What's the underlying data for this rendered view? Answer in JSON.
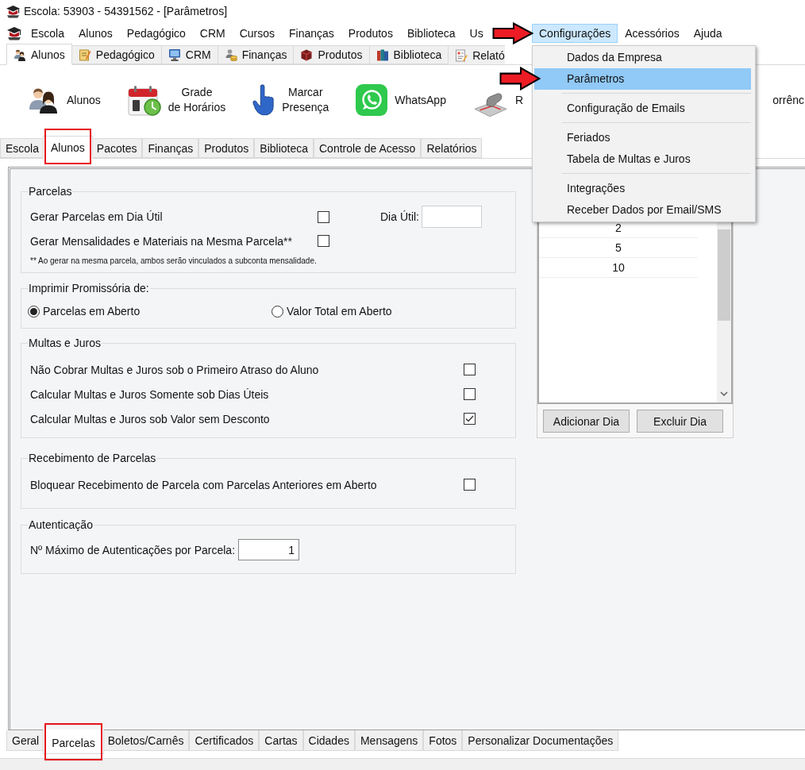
{
  "window": {
    "title": "Escola: 53903 - 54391562 - [Parâmetros]"
  },
  "menu_bar": {
    "items": [
      {
        "label": "Escola",
        "selected": false,
        "pointer_arrow": false
      },
      {
        "label": "Alunos",
        "selected": false,
        "pointer_arrow": false
      },
      {
        "label": "Pedagógico",
        "selected": false,
        "pointer_arrow": false
      },
      {
        "label": "CRM",
        "selected": false,
        "pointer_arrow": false
      },
      {
        "label": "Cursos",
        "selected": false,
        "pointer_arrow": false
      },
      {
        "label": "Finanças",
        "selected": false,
        "pointer_arrow": false
      },
      {
        "label": "Produtos",
        "selected": false,
        "pointer_arrow": false
      },
      {
        "label": "Biblioteca",
        "selected": false,
        "pointer_arrow": false
      },
      {
        "label": "Us",
        "selected": false,
        "pointer_arrow": false
      },
      {
        "label": "Configurações",
        "selected": true,
        "pointer_arrow": true
      },
      {
        "label": "Acessórios",
        "selected": false,
        "pointer_arrow": false
      },
      {
        "label": "Ajuda",
        "selected": false,
        "pointer_arrow": false
      }
    ]
  },
  "dropdown_menu": {
    "items": [
      {
        "kind": "item",
        "label": "Dados da Empresa",
        "selected": false,
        "pointer_arrow": false
      },
      {
        "kind": "item",
        "label": "Parâmetros",
        "selected": true,
        "pointer_arrow": true
      },
      {
        "kind": "separator"
      },
      {
        "kind": "item",
        "label": "Configuração de Emails",
        "selected": false,
        "pointer_arrow": false
      },
      {
        "kind": "separator"
      },
      {
        "kind": "item",
        "label": "Feriados",
        "selected": false,
        "pointer_arrow": false
      },
      {
        "kind": "item",
        "label": "Tabela de Multas e Juros",
        "selected": false,
        "pointer_arrow": false
      },
      {
        "kind": "separator"
      },
      {
        "kind": "item",
        "label": "Integrações",
        "selected": false,
        "pointer_arrow": false
      },
      {
        "kind": "item",
        "label": "Receber Dados por Email/SMS",
        "selected": false,
        "pointer_arrow": false
      }
    ]
  },
  "module_tabs": [
    {
      "label": "Alunos",
      "selected": true
    },
    {
      "label": "Pedagógico",
      "selected": false
    },
    {
      "label": "CRM",
      "selected": false
    },
    {
      "label": "Finanças",
      "selected": false
    },
    {
      "label": "Produtos",
      "selected": false
    },
    {
      "label": "Biblioteca",
      "selected": false
    },
    {
      "label": "Relató",
      "selected": false
    }
  ],
  "ribbon": {
    "items": [
      {
        "label": "Alunos"
      },
      {
        "label": "Grade\nde Horários"
      },
      {
        "label": "Marcar\nPresença"
      },
      {
        "label": "WhatsApp"
      },
      {
        "label": "R"
      },
      {
        "label": "orrênc"
      }
    ]
  },
  "section_tabs": [
    {
      "label": "Escola",
      "selected": false,
      "highlight_frame": false
    },
    {
      "label": "Alunos",
      "selected": true,
      "highlight_frame": true
    },
    {
      "label": "Pacotes",
      "selected": false,
      "highlight_frame": false
    },
    {
      "label": "Finanças",
      "selected": false,
      "highlight_frame": false
    },
    {
      "label": "Produtos",
      "selected": false,
      "highlight_frame": false
    },
    {
      "label": "Biblioteca",
      "selected": false,
      "highlight_frame": false
    },
    {
      "label": "Controle de Acesso",
      "selected": false,
      "highlight_frame": false
    },
    {
      "label": "Relatórios",
      "selected": false,
      "highlight_frame": false
    }
  ],
  "form": {
    "groups": [
      {
        "title": "Parcelas",
        "rows": [
          {
            "kind": "checkbox_field",
            "label": "Gerar Parcelas em Dia Útil",
            "checked": false,
            "field_label": "Dia Útil:"
          },
          {
            "kind": "checkbox",
            "label": "Gerar Mensalidades e Materiais na Mesma Parcela**",
            "checked": false
          },
          {
            "kind": "note",
            "text": "** Ao gerar na mesma parcela, ambos serão vinculados a subconta mensalidade."
          }
        ]
      },
      {
        "title": "Imprimir Promissória de:",
        "rows": [
          {
            "kind": "radios",
            "options": [
              {
                "label": "Parcelas em Aberto",
                "selected": true
              },
              {
                "label": "Valor Total em Aberto",
                "selected": false
              }
            ]
          }
        ]
      },
      {
        "title": "Multas e Juros",
        "rows": [
          {
            "kind": "checkbox",
            "label": "Não Cobrar Multas e Juros sob o Primeiro Atraso do Aluno",
            "checked": false
          },
          {
            "kind": "checkbox",
            "label": "Calcular Multas e Juros Somente sob Dias Úteis",
            "checked": false
          },
          {
            "kind": "checkbox",
            "label": "Calcular Multas e Juros sob Valor sem Desconto",
            "checked": true
          }
        ]
      },
      {
        "title": "Recebimento de Parcelas",
        "rows": [
          {
            "kind": "checkbox",
            "label": "Bloquear Recebimento de Parcela com Parcelas Anteriores em Aberto",
            "checked": false
          }
        ]
      },
      {
        "title": "Autenticação",
        "rows": [
          {
            "kind": "number",
            "label": "Nº Máximo de Autenticações por Parcela:",
            "value": "1"
          }
        ]
      }
    ]
  },
  "days_list": {
    "rows": [
      "2",
      "5",
      "10"
    ],
    "buttons": [
      "Adicionar Dia",
      "Excluir Dia"
    ]
  },
  "page_tabs": [
    {
      "label": "Geral",
      "selected": false,
      "highlight_frame": false
    },
    {
      "label": "Parcelas",
      "selected": true,
      "highlight_frame": true
    },
    {
      "label": "Boletos/Carnês",
      "selected": false,
      "highlight_frame": false
    },
    {
      "label": "Certificados",
      "selected": false,
      "highlight_frame": false
    },
    {
      "label": "Cartas",
      "selected": false,
      "highlight_frame": false
    },
    {
      "label": "Cidades",
      "selected": false,
      "highlight_frame": false
    },
    {
      "label": "Mensagens",
      "selected": false,
      "highlight_frame": false
    },
    {
      "label": "Fotos",
      "selected": false,
      "highlight_frame": false
    },
    {
      "label": "Personalizar Documentações",
      "selected": false,
      "highlight_frame": false
    }
  ]
}
